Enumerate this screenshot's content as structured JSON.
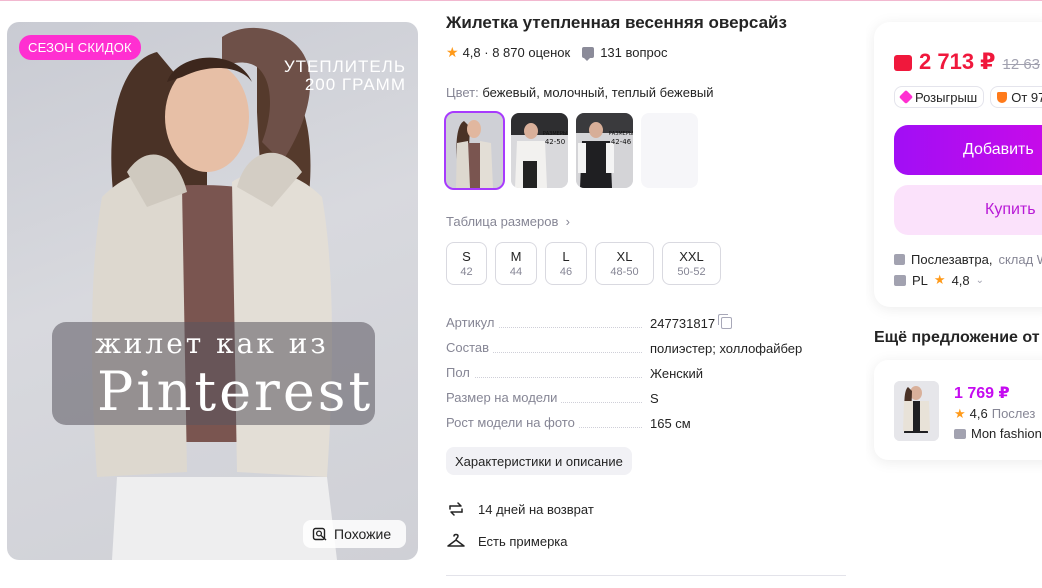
{
  "product": {
    "title": "Жилетка утепленная весенняя оверсайз",
    "rating": "4,8",
    "reviews": "8 870 оценок",
    "questions": "131 вопрос",
    "color_label": "Цвет:",
    "color_value": "бежевый, молочный, теплый бежевый"
  },
  "photo": {
    "sale_badge": "СЕЗОН СКИДОК",
    "caption_line1": "УТЕПЛИТЕЛЬ",
    "caption_line2": "200 ГРАММ",
    "overlay_line1": "жилет как из",
    "overlay_line2": "Pinterest",
    "similar_label": "Похожие"
  },
  "thumbnails": [
    {
      "label": "",
      "selected": true
    },
    {
      "label": "РАЗМЕРЫ 42-50",
      "selected": false
    },
    {
      "label": "РАЗМЕРЫ 42-46",
      "selected": false
    },
    {
      "label": "",
      "selected": false
    }
  ],
  "sizes": {
    "table_link": "Таблица размеров",
    "items": [
      {
        "size": "S",
        "ru": "42"
      },
      {
        "size": "M",
        "ru": "44"
      },
      {
        "size": "L",
        "ru": "46"
      },
      {
        "size": "XL",
        "ru": "48-50"
      },
      {
        "size": "XXL",
        "ru": "50-52"
      }
    ]
  },
  "specs": [
    {
      "key": "Артикул",
      "value": "247731817"
    },
    {
      "key": "Состав",
      "value": "полиэстер; холлофайбер"
    },
    {
      "key": "Пол",
      "value": "Женский"
    },
    {
      "key": "Размер на модели",
      "value": "S"
    },
    {
      "key": "Рост модели на фото",
      "value": "165 см"
    }
  ],
  "description_button": "Характеристики и описание",
  "features": {
    "return": "14 дней на возврат",
    "fitting": "Есть примерка"
  },
  "buy": {
    "price": "2 713 ₽",
    "old_price": "12 63",
    "chip_lottery": "Розыгрыш",
    "chip_from": "От 97",
    "add_button": "Добавить",
    "buy_button": "Купить",
    "delivery_when": "Послезавтра,",
    "delivery_where": "склад W",
    "seller_name": "PL",
    "seller_rating": "4,8"
  },
  "other_offer": {
    "title": "Ещё предложение от",
    "price": "1 769 ₽",
    "rating": "4,6",
    "delivery": "Послез",
    "seller": "Mon fashion"
  },
  "colors": {
    "accent": "#a73afd",
    "price_red": "#f0183c",
    "sale_pink": "#ff2fd1",
    "star": "#ff9a1a"
  }
}
